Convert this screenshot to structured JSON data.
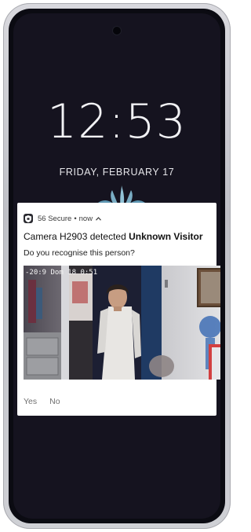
{
  "lockscreen": {
    "time": "12:53",
    "date": "FRIDAY, FEBRUARY 17"
  },
  "notification": {
    "app_icon": "shield-icon",
    "app_name": "56 Secure",
    "separator": "•",
    "time_ago": "now",
    "expand_icon": "chevron-up-icon",
    "title_prefix": "Camera H2903 detected ",
    "title_bold": "Unknown Visitor",
    "body": "Do you recognise this person?",
    "snapshot": {
      "timestamp_overlay": "-20:9 Dom 18 0:51"
    },
    "actions": [
      "Yes",
      "No"
    ]
  },
  "colors": {
    "lockscreen_bg": "#15131f",
    "notification_bg": "#ffffff",
    "action_text": "#707070"
  }
}
